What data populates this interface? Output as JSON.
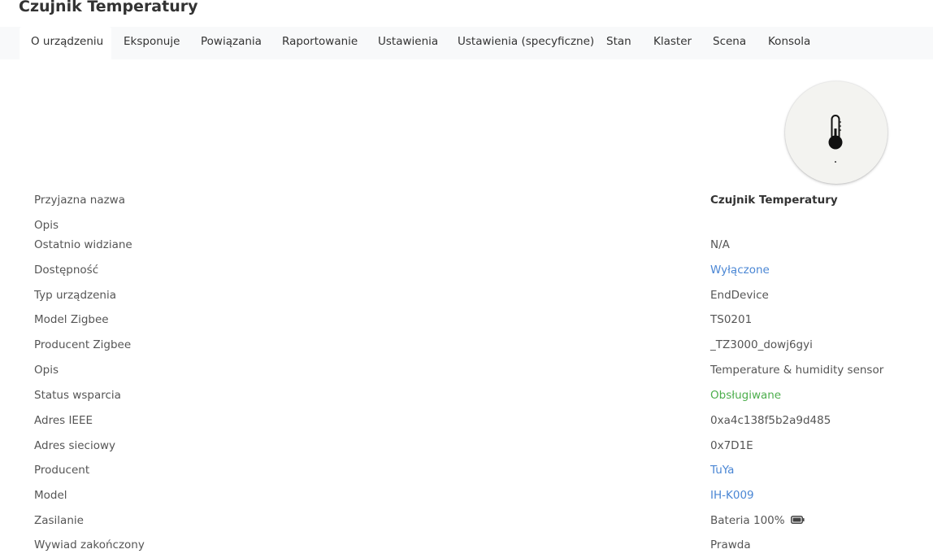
{
  "title": "Czujnik Temperatury",
  "tabs": [
    {
      "label": "O urządzeniu",
      "active": true
    },
    {
      "label": "Eksponuje"
    },
    {
      "label": "Powiązania"
    },
    {
      "label": "Raportowanie"
    },
    {
      "label": "Ustawienia"
    },
    {
      "label": "Ustawienia (specyficzne)"
    },
    {
      "label": "Stan"
    },
    {
      "label": "Klaster"
    },
    {
      "label": "Scena"
    },
    {
      "label": "Konsola"
    }
  ],
  "device_image_icon": "thermometer-icon",
  "details": [
    {
      "label": "Przyjazna nazwa",
      "value": "Czujnik Temperatury",
      "style": "bold"
    },
    {
      "label": "Opis",
      "value": ""
    },
    {
      "label": "Ostatnio widziane",
      "value": "N/A"
    },
    {
      "label": "Dostępność",
      "value": "Wyłączone",
      "style": "link"
    },
    {
      "label": "Typ urządzenia",
      "value": "EndDevice"
    },
    {
      "label": "Model Zigbee",
      "value": "TS0201"
    },
    {
      "label": "Producent Zigbee",
      "value": "_TZ3000_dowj6gyi"
    },
    {
      "label": "Opis",
      "value": "Temperature & humidity sensor"
    },
    {
      "label": "Status wsparcia",
      "value": "Obsługiwane",
      "style": "success"
    },
    {
      "label": "Adres IEEE",
      "value": "0xa4c138f5b2a9d485"
    },
    {
      "label": "Adres sieciowy",
      "value": "0x7D1E"
    },
    {
      "label": "Producent",
      "value": "TuYa",
      "style": "link"
    },
    {
      "label": "Model",
      "value": "IH-K009",
      "style": "link"
    },
    {
      "label": "Zasilanie",
      "value": "Bateria 100%",
      "icon": "battery-full-icon"
    },
    {
      "label": "Wywiad zakończony",
      "value": "Prawda"
    }
  ],
  "colors": {
    "link": "#4a86d4",
    "success": "#4cae4c",
    "tabbar_bg": "#f8f9fa"
  }
}
